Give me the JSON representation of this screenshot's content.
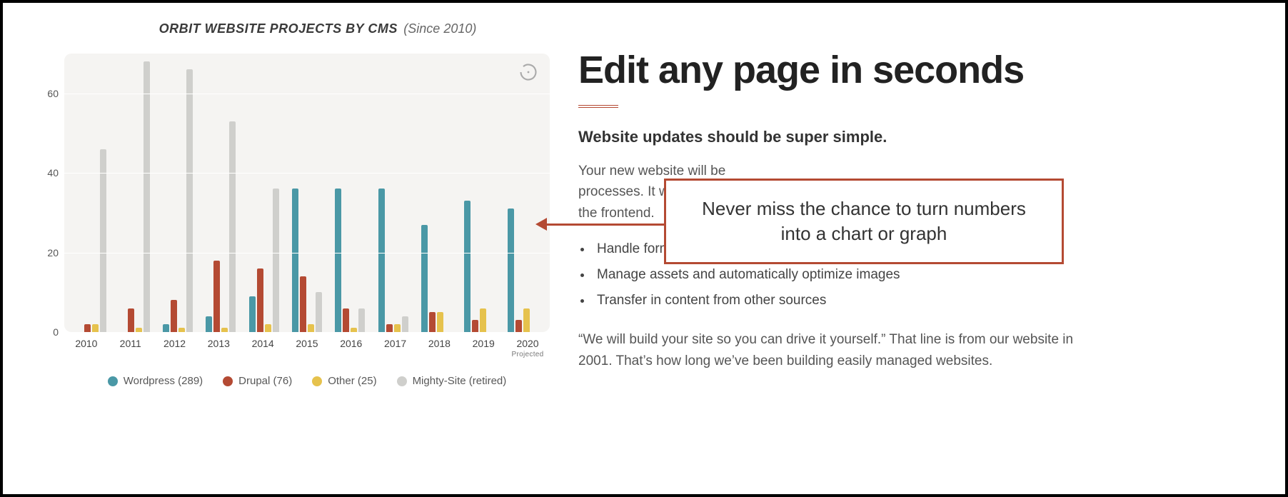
{
  "chart_title": "ORBIT WEBSITE PROJECTS BY CMS",
  "chart_subtitle": "(Since 2010)",
  "projected_label": "Projected",
  "y_axis": {
    "min": 0,
    "max": 70,
    "ticks": [
      0,
      20,
      40,
      60
    ]
  },
  "series_meta": [
    {
      "key": "wordpress",
      "label": "Wordpress (289)",
      "color": "#4a98a6"
    },
    {
      "key": "drupal",
      "label": "Drupal (76)",
      "color": "#b44a33"
    },
    {
      "key": "other",
      "label": "Other (25)",
      "color": "#e6c24d"
    },
    {
      "key": "mighty",
      "label": "Mighty-Site (retired)",
      "color": "#cfcfcc"
    }
  ],
  "content": {
    "headline": "Edit any page in seconds",
    "subhead": "Website updates should be super simple.",
    "para1_visible": "Your new website will be",
    "para2_visible": "processes. It will be easy",
    "para3_visible": "the frontend.",
    "bullets": [
      "Handle formatting, pla",
      "Manage assets and automatically optimize images",
      "Transfer in content from other sources"
    ],
    "quote": "“We will build your site so you can drive it yourself.” That line is from our website in 2001. That’s how long we’ve been building easily managed websites."
  },
  "callout_text": "Never miss the chance to turn numbers into a chart or graph",
  "chart_data": {
    "type": "bar",
    "title": "ORBIT WEBSITE PROJECTS BY CMS (Since 2010)",
    "xlabel": "",
    "ylabel": "",
    "ylim": [
      0,
      70
    ],
    "categories": [
      "2010",
      "2011",
      "2012",
      "2013",
      "2014",
      "2015",
      "2016",
      "2017",
      "2018",
      "2019",
      "2020"
    ],
    "series": [
      {
        "name": "Wordpress (289)",
        "values": [
          0,
          0,
          2,
          4,
          9,
          36,
          36,
          36,
          27,
          33,
          31
        ]
      },
      {
        "name": "Drupal (76)",
        "values": [
          2,
          6,
          8,
          18,
          16,
          14,
          6,
          2,
          5,
          3,
          3
        ]
      },
      {
        "name": "Other (25)",
        "values": [
          2,
          1,
          1,
          1,
          2,
          2,
          1,
          2,
          5,
          6,
          6
        ]
      },
      {
        "name": "Mighty-Site (retired)",
        "values": [
          46,
          68,
          66,
          53,
          36,
          10,
          6,
          4,
          0,
          0,
          0
        ]
      }
    ],
    "notes": {
      "2020": "Projected"
    }
  }
}
